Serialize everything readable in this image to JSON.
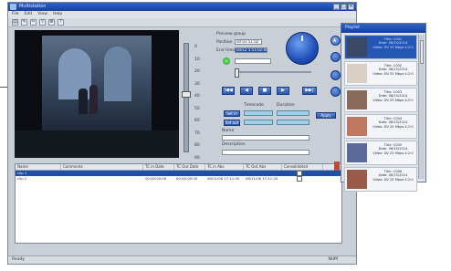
{
  "main_window": {
    "title": "Multistation",
    "menu": [
      "File",
      "Edit",
      "View",
      "Help"
    ],
    "toolbar_icons": [
      "open-icon",
      "edit-icon",
      "cut-icon",
      "export-icon",
      "settings-icon",
      "help-icon"
    ]
  },
  "scale_labels": [
    "0",
    "10",
    "20",
    "30",
    "40",
    "50",
    "60",
    "70",
    "80",
    "90"
  ],
  "controls": {
    "preview_label": "Preview group",
    "position_label": "Position",
    "position_value": "00:01:51:02",
    "end_time_label": "End time",
    "end_time_value": "00/12 5:51:02:00",
    "transport_buttons": [
      "|◀◀",
      "◀",
      "■",
      "▶",
      "▶▶|"
    ],
    "set_in_label": "Set in",
    "set_out_label": "Set out",
    "timecode_label": "Timecode",
    "duration_label": "Duration",
    "apply_label": "Apply",
    "name_label": "Name",
    "description_label": "Description"
  },
  "table": {
    "columns": [
      "Name",
      "Comments",
      "TC in Date",
      "TC Out Date",
      "TC in Abs",
      "TC Out Abs",
      "Consolidated"
    ],
    "rows": [
      {
        "name": "clip 1",
        "comments": "",
        "tc_in_date": "",
        "tc_out_date": "",
        "tc_in_abs": "",
        "tc_out_abs": "",
        "selected": true
      },
      {
        "name": "clip 2",
        "comments": "",
        "tc_in_date": "00:00:00:00",
        "tc_out_date": "00:00:00:00",
        "tc_in_abs": "08/11/06 17:11:00",
        "tc_out_abs": "08/11/06 17:11:20",
        "selected": false
      }
    ]
  },
  "status": {
    "left": "Ready",
    "right": "NUM"
  },
  "side_window": {
    "title": "Playlist",
    "clips": [
      {
        "title": "Title: C001",
        "date": "Date: 08/15/2014",
        "format": "Video: DV 25 Mbps 4:2:0",
        "selected": true
      },
      {
        "title": "Title: C002",
        "date": "Date: 08/15/2014",
        "format": "Video: DV 25 Mbps 4:2:0",
        "selected": false
      },
      {
        "title": "Title: C003",
        "date": "Date: 08/15/2014",
        "format": "Video: DV 25 Mbps 4:2:0",
        "selected": false
      },
      {
        "title": "Title: C004",
        "date": "Date: 08/15/2014",
        "format": "Video: DV 25 Mbps 4:2:0",
        "selected": false
      },
      {
        "title": "Title: C005",
        "date": "Date: 08/15/2014",
        "format": "Video: DV 25 Mbps 4:2:0",
        "selected": false
      },
      {
        "title": "Title: C006",
        "date": "Date: 08/15/2014",
        "format": "Video: DV 25 Mbps 4:2:0",
        "selected": false
      }
    ],
    "thumb_colors": [
      "#3a4a66",
      "#d9cfc4",
      "#8a6a58",
      "#c07860",
      "#5a6a9a",
      "#9a5a4a"
    ]
  }
}
